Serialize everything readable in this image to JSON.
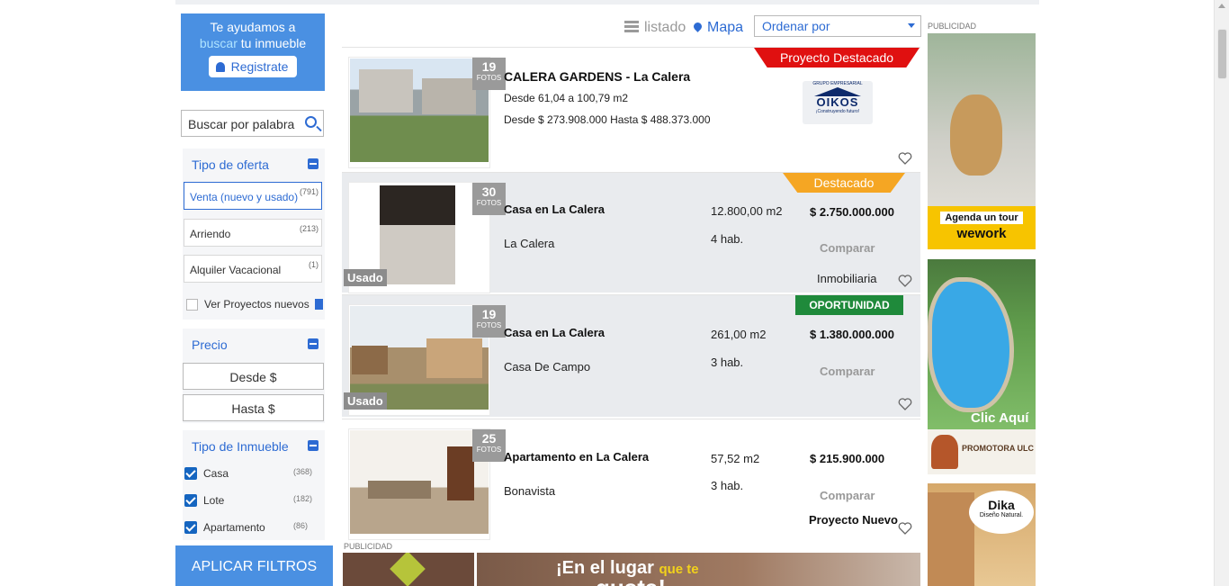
{
  "sidebar": {
    "promo": {
      "line1": "Te ayudamos a",
      "highlight": "buscar",
      "line2": " tu inmueble",
      "button": "Registrate"
    },
    "search_placeholder": "Buscar por palabra",
    "oferta": {
      "title": "Tipo de oferta",
      "options": [
        {
          "label": "Venta (nuevo y usado)",
          "count": "(791)"
        },
        {
          "label": "Arriendo",
          "count": "(213)"
        },
        {
          "label": "Alquiler Vacacional",
          "count": "(1)"
        }
      ],
      "projects_label": "Ver Proyectos nuevos"
    },
    "precio": {
      "title": "Precio",
      "from": "Desde $",
      "to": "Hasta $"
    },
    "inmueble": {
      "title": "Tipo de Inmueble",
      "options": [
        {
          "label": "Casa",
          "count": "(368)"
        },
        {
          "label": "Lote",
          "count": "(182)"
        },
        {
          "label": "Apartamento",
          "count": "(86)"
        }
      ]
    },
    "apply": "APLICAR FILTROS"
  },
  "toolbar": {
    "list": "listado",
    "map": "Mapa",
    "order": "Ordenar por"
  },
  "listings": [
    {
      "photos": "19",
      "photos_label": "FOTOS",
      "ribbon": "Proyecto Destacado",
      "title": "CALERA GARDENS - La Calera",
      "line1": "Desde 61,04 a 100,79 m2",
      "line2": "Desde $ 273.908.000 Hasta $ 488.373.000",
      "logo_top": "GRUPO EMPRESARIAL",
      "logo_word": "OIKOS",
      "logo_slogan": "¡Construyendo futuro!"
    },
    {
      "photos": "30",
      "photos_label": "FOTOS",
      "badge": "Usado",
      "ribbon": "Destacado",
      "title": "Casa en La Calera",
      "sub": "La Calera",
      "area": "12.800,00 m2",
      "rooms": "4 hab.",
      "price": "$ 2.750.000.000",
      "compare": "Comparar",
      "agency": "Inmobiliaria"
    },
    {
      "photos": "19",
      "photos_label": "FOTOS",
      "badge": "Usado",
      "ribbon": "OPORTUNIDAD",
      "title": "Casa en La Calera",
      "sub": "Casa De Campo",
      "area": "261,00 m2",
      "rooms": "3 hab.",
      "price": "$ 1.380.000.000",
      "compare": "Comparar"
    },
    {
      "photos": "25",
      "photos_label": "FOTOS",
      "title": "Apartamento en La Calera",
      "sub": "Bonavista",
      "area": "57,52 m2",
      "rooms": "3 hab.",
      "price": "$ 215.900.000",
      "compare": "Comparar",
      "agency": "Proyecto Nuevo"
    }
  ],
  "ads": {
    "label": "PUBLICIDAD",
    "wework_cta": "Agenda un tour",
    "wework_brand": "wework",
    "promotora_cta": "Clic Aquí",
    "promotora_name": "PROMOTORA ULC",
    "dika_name": "Dika",
    "dika_slogan": "Diseño Natural.",
    "bottom_text": "¡En el lugar",
    "bottom_text_yellow": "que te",
    "bottom_text_line2": "gusta!"
  },
  "colors": {
    "primary": "#4a90e2",
    "link": "#2d6bd3",
    "ribbon_red": "#e01010",
    "ribbon_orange": "#f5a623",
    "ribbon_green": "#1f8a3b"
  }
}
